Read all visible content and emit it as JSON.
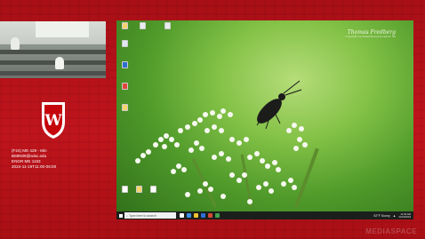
{
  "course_info": {
    "line1": "(F24) ME 429 - Min",
    "line2": "BMIN09@wisc.edu",
    "line3": "ENGR ME 1163",
    "line4": "2024-11-19T11:00-06:00"
  },
  "desktop": {
    "wallpaper_signature": "Thomas Fredberg",
    "wallpaper_subtitle": "Copyright not determined photo/iphoto file",
    "icons": [
      {
        "name": "folder-icon",
        "color": "#f5d46b"
      },
      {
        "name": "recycle-bin-icon",
        "color": "#dfe7f0"
      },
      {
        "name": "app-icon",
        "color": "#2e6fd0"
      },
      {
        "name": "pdf-icon",
        "color": "#e0453a"
      },
      {
        "name": "document-icon",
        "color": "#f5d46b"
      },
      {
        "name": "file-icon",
        "color": "#ffffff"
      },
      {
        "name": "folder-icon",
        "color": "#f5d46b"
      },
      {
        "name": "file-icon",
        "color": "#ffffff"
      }
    ]
  },
  "taskbar": {
    "search_placeholder": "Type here to search",
    "weather": "52°F Sunny",
    "time": "11:02 AM",
    "date": "11/19/2024",
    "app_colors": [
      "#ffffff",
      "#3c8ee8",
      "#f1c232",
      "#2f6fd8",
      "#d44a35",
      "#3fa34d"
    ]
  },
  "watermark": "MEDIASPACE",
  "colors": {
    "brand_red": "#b3141a",
    "taskbar": "#1b1f1c"
  }
}
